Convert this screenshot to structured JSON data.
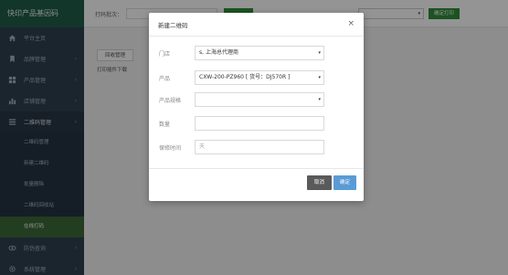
{
  "brand": "快印产品基因码",
  "sidebar": {
    "items": [
      {
        "label": "平台主页",
        "icon": "home-icon"
      },
      {
        "label": "品牌管理",
        "icon": "bookmark-icon",
        "chevron": "‹"
      },
      {
        "label": "产品管理",
        "icon": "grid-icon",
        "chevron": "‹"
      },
      {
        "label": "店铺管理",
        "icon": "chart-icon",
        "chevron": "‹"
      },
      {
        "label": "二维码管理",
        "icon": "list-icon",
        "chevron": "‹"
      }
    ],
    "submenu": [
      {
        "label": "二维码管理"
      },
      {
        "label": "新建二维码"
      },
      {
        "label": "批量删除"
      },
      {
        "label": "二维码回收站"
      },
      {
        "label": "在线打码"
      }
    ],
    "bottom_items": [
      {
        "label": "防伪查询",
        "icon": "eye-icon",
        "chevron": "‹"
      },
      {
        "label": "系统管理",
        "icon": "gear-icon",
        "chevron": "‹"
      }
    ]
  },
  "topbar": {
    "label": "打码批次：",
    "select_arrow": "▾",
    "print_label": "确定打印"
  },
  "main": {
    "mgmt_button": "回收管理",
    "download_link": "打印插件下载"
  },
  "modal": {
    "title": "新建二维码",
    "close": "×",
    "fields": {
      "store": {
        "label": "门店",
        "value": "s, 上海总代理商",
        "arrow": "▾"
      },
      "product": {
        "label": "产品",
        "value": "CXW-200-PZ960 [ 货号：DJ570R ]",
        "arrow": "▾"
      },
      "spec": {
        "label": "产品规格",
        "value": "",
        "arrow": "▾"
      },
      "quantity": {
        "label": "数量",
        "value": ""
      },
      "warranty": {
        "label": "保修时间",
        "placeholder": "天"
      }
    },
    "cancel_label": "取消",
    "ok_label": "确定"
  },
  "colors": {
    "sidebar_bg": "#2f4050",
    "brand_bg": "#1f5d48",
    "active_item": "#3d6a37",
    "primary_green": "#2f8f3a",
    "ok_blue": "#5b9bd5",
    "cancel_gray": "#5a5a5a"
  }
}
